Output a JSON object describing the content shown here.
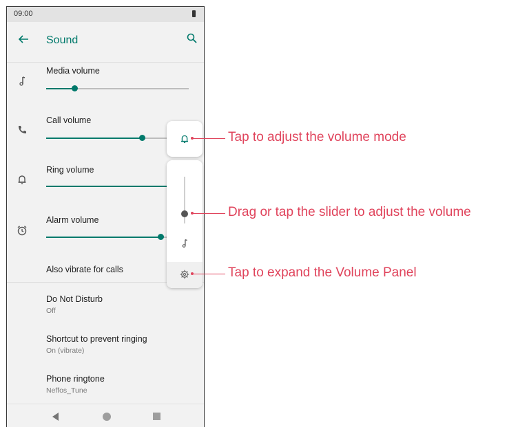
{
  "status_bar": {
    "time": "09:00"
  },
  "app_bar": {
    "title": "Sound"
  },
  "volumes": [
    {
      "label": "Media volume",
      "level": 0.2
    },
    {
      "label": "Call volume",
      "level": 0.67
    },
    {
      "label": "Ring volume",
      "level": 1.0
    },
    {
      "label": "Alarm volume",
      "level": 0.8
    }
  ],
  "items": {
    "vibrate": {
      "label": "Also vibrate for calls"
    },
    "dnd": {
      "label": "Do Not Disturb",
      "sub": "Off"
    },
    "shortcut": {
      "label": "Shortcut to prevent ringing",
      "sub": "On (vibrate)"
    },
    "ringtone": {
      "label": "Phone ringtone",
      "sub": "Neffos_Tune"
    }
  },
  "callouts": {
    "mode": "Tap to adjust the volume mode",
    "slider": "Drag or tap the slider to adjust the volume",
    "expand": "Tap to expand the Volume Panel"
  },
  "colors": {
    "accent": "#00796b",
    "callout": "#e0445c"
  },
  "icons": [
    "back-arrow-icon",
    "search-icon",
    "music-note-icon",
    "phone-icon",
    "bell-icon",
    "alarm-clock-icon",
    "gear-icon"
  ]
}
